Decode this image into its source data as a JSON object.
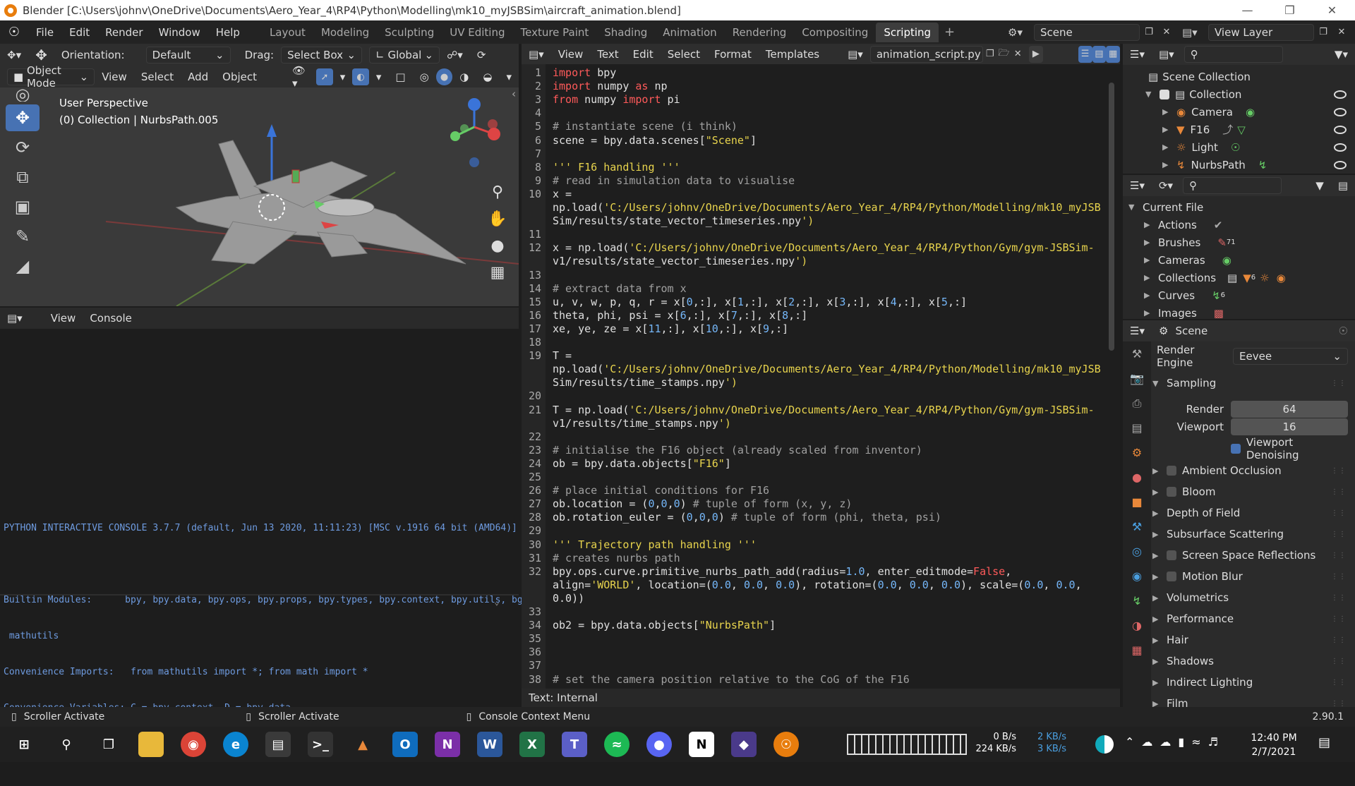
{
  "window": {
    "title": "Blender [C:\\Users\\johnv\\OneDrive\\Documents\\Aero_Year_4\\RP4\\Python\\Modelling\\mk10_myJSBSim\\aircraft_animation.blend]"
  },
  "menu": [
    "File",
    "Edit",
    "Render",
    "Window",
    "Help"
  ],
  "workspaces": [
    "Layout",
    "Modeling",
    "Sculpting",
    "UV Editing",
    "Texture Paint",
    "Shading",
    "Animation",
    "Rendering",
    "Compositing",
    "Scripting"
  ],
  "active_workspace": "Scripting",
  "scene_field": "Scene",
  "view_layer_field": "View Layer",
  "viewport_header": {
    "orientation_label": "Orientation:",
    "orientation_value": "Default",
    "drag_label": "Drag:",
    "drag_value": "Select Box",
    "transform_value": "Global",
    "mode": "Object Mode",
    "menus": [
      "View",
      "Select",
      "Add",
      "Object"
    ]
  },
  "viewport": {
    "perspective": "User Perspective",
    "collection_info": "(0) Collection | NurbsPath.005"
  },
  "console": {
    "menus": [
      "View",
      "Console"
    ],
    "lines": [
      "PYTHON INTERACTIVE CONSOLE 3.7.7 (default, Jun 13 2020, 11:11:23) [MSC v.1916 64 bit (AMD64)]",
      "",
      "Builtin Modules:      bpy, bpy.data, bpy.ops, bpy.props, bpy.types, bpy.context, bpy.utils, bgl, blf,",
      " mathutils",
      "Convenience Imports:   from mathutils import *; from math import *",
      "Convenience Variables: C = bpy.context, D = bpy.data"
    ],
    "prompt": ">>> "
  },
  "text_editor": {
    "menus": [
      "View",
      "Text",
      "Edit",
      "Select",
      "Format",
      "Templates"
    ],
    "filename": "animation_script.py",
    "footer": "Text: Internal"
  },
  "code_lines": [
    {
      "n": "1",
      "t": "import bpy"
    },
    {
      "n": "2",
      "t": "import numpy as np"
    },
    {
      "n": "3",
      "t": "from numpy import pi"
    },
    {
      "n": "4",
      "t": ""
    },
    {
      "n": "5",
      "t": "# instantiate scene (i think)"
    },
    {
      "n": "6",
      "t": "scene = bpy.data.scenes[\"Scene\"]"
    },
    {
      "n": "7",
      "t": ""
    },
    {
      "n": "8",
      "t": "''' F16 handling '''"
    },
    {
      "n": "9",
      "t": "# read in simulation data to visualise"
    },
    {
      "n": "10",
      "t": "x ="
    },
    {
      "n": "",
      "t": "np.load('C:/Users/johnv/OneDrive/Documents/Aero_Year_4/RP4/Python/Modelling/mk10_myJSB"
    },
    {
      "n": "",
      "t": "Sim/results/state_vector_timeseries.npy')"
    },
    {
      "n": "11",
      "t": ""
    },
    {
      "n": "12",
      "t": "x = np.load('C:/Users/johnv/OneDrive/Documents/Aero_Year_4/RP4/Python/Gym/gym-JSBSim-"
    },
    {
      "n": "",
      "t": "v1/results/state_vector_timeseries.npy')"
    },
    {
      "n": "13",
      "t": ""
    },
    {
      "n": "14",
      "t": "# extract data from x"
    },
    {
      "n": "15",
      "t": "u, v, w, p, q, r = x[0,:], x[1,:], x[2,:], x[3,:], x[4,:], x[5,:]"
    },
    {
      "n": "16",
      "t": "theta, phi, psi = x[6,:], x[7,:], x[8,:]"
    },
    {
      "n": "17",
      "t": "xe, ye, ze = x[11,:], x[10,:], x[9,:]"
    },
    {
      "n": "18",
      "t": ""
    },
    {
      "n": "19",
      "t": "T ="
    },
    {
      "n": "",
      "t": "np.load('C:/Users/johnv/OneDrive/Documents/Aero_Year_4/RP4/Python/Modelling/mk10_myJSB"
    },
    {
      "n": "",
      "t": "Sim/results/time_stamps.npy')"
    },
    {
      "n": "20",
      "t": ""
    },
    {
      "n": "21",
      "t": "T = np.load('C:/Users/johnv/OneDrive/Documents/Aero_Year_4/RP4/Python/Gym/gym-JSBSim-"
    },
    {
      "n": "",
      "t": "v1/results/time_stamps.npy')"
    },
    {
      "n": "22",
      "t": ""
    },
    {
      "n": "23",
      "t": "# initialise the F16 object (already scaled from inventor)"
    },
    {
      "n": "24",
      "t": "ob = bpy.data.objects[\"F16\"]"
    },
    {
      "n": "25",
      "t": ""
    },
    {
      "n": "26",
      "t": "# place initial conditions for F16"
    },
    {
      "n": "27",
      "t": "ob.location = (0,0,0) # tuple of form (x, y, z)"
    },
    {
      "n": "28",
      "t": "ob.rotation_euler = (0,0,0) # tuple of form (phi, theta, psi)"
    },
    {
      "n": "29",
      "t": ""
    },
    {
      "n": "30",
      "t": "''' Trajectory path handling '''"
    },
    {
      "n": "31",
      "t": "# creates nurbs path"
    },
    {
      "n": "32",
      "t": "bpy.ops.curve.primitive_nurbs_path_add(radius=1.0, enter_editmode=False,"
    },
    {
      "n": "",
      "t": "align='WORLD', location=(0.0, 0.0, 0.0), rotation=(0.0, 0.0, 0.0), scale=(0.0, 0.0,"
    },
    {
      "n": "",
      "t": "0.0))"
    },
    {
      "n": "33",
      "t": ""
    },
    {
      "n": "34",
      "t": "ob2 = bpy.data.objects[\"NurbsPath\"]"
    },
    {
      "n": "35",
      "t": ""
    },
    {
      "n": "36",
      "t": ""
    },
    {
      "n": "37",
      "t": ""
    },
    {
      "n": "38",
      "t": "# set the camera position relative to the CoG of the F16"
    }
  ],
  "outliner": {
    "root": "Scene Collection",
    "collection": "Collection",
    "items": [
      "Camera",
      "F16",
      "Light",
      "NurbsPath"
    ]
  },
  "data_browser": {
    "root": "Current File",
    "items": [
      "Actions",
      "Brushes",
      "Cameras",
      "Collections",
      "Curves",
      "Images"
    ],
    "badges": {
      "Brushes": "71",
      "Collections": "6",
      "Curves": "6"
    }
  },
  "properties": {
    "context": "Scene",
    "render_engine_label": "Render Engine",
    "render_engine": "Eevee",
    "sampling": "Sampling",
    "render_label": "Render",
    "render_value": "64",
    "viewport_label": "Viewport",
    "viewport_value": "16",
    "denoise": "Viewport Denoising",
    "panels": [
      {
        "label": "Ambient Occlusion",
        "checkbox": true
      },
      {
        "label": "Bloom",
        "checkbox": true
      },
      {
        "label": "Depth of Field",
        "checkbox": false
      },
      {
        "label": "Subsurface Scattering",
        "checkbox": false
      },
      {
        "label": "Screen Space Reflections",
        "checkbox": true
      },
      {
        "label": "Motion Blur",
        "checkbox": true
      },
      {
        "label": "Volumetrics",
        "checkbox": false
      },
      {
        "label": "Performance",
        "checkbox": false
      },
      {
        "label": "Hair",
        "checkbox": false
      },
      {
        "label": "Shadows",
        "checkbox": false
      },
      {
        "label": "Indirect Lighting",
        "checkbox": false
      },
      {
        "label": "Film",
        "checkbox": false
      }
    ]
  },
  "statusbar": {
    "items": [
      "Scroller Activate",
      "Scroller Activate",
      "Console Context Menu"
    ],
    "version": "2.90.1"
  },
  "taskbar": {
    "net_down": "0 B/s",
    "net_up": "224 KB/s",
    "net2_a": "2 KB/s",
    "net2_b": "3 KB/s",
    "time": "12:40 PM",
    "date": "2/7/2021"
  }
}
